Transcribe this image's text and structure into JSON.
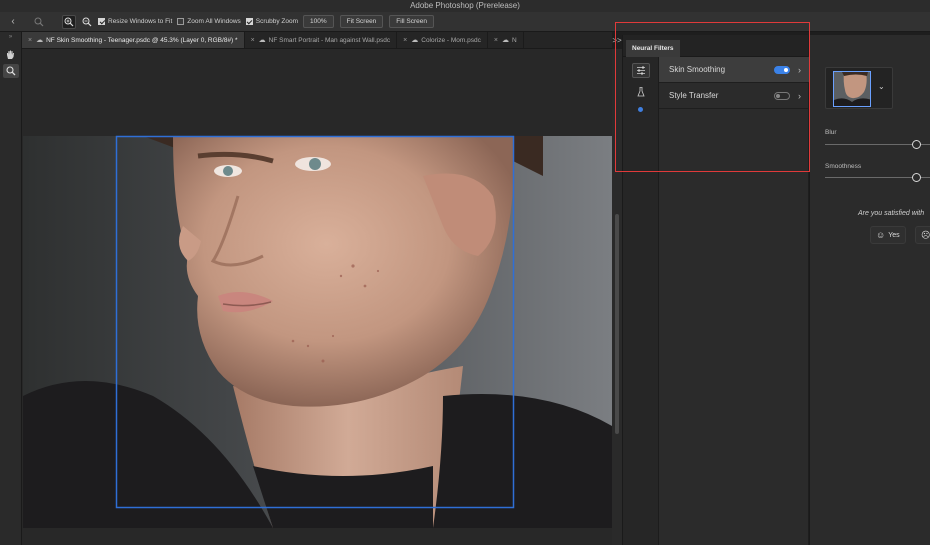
{
  "app": {
    "title": "Adobe Photoshop (Prerelease)"
  },
  "options_bar": {
    "back_icon": "chevron-left-icon",
    "resize_windows": {
      "label": "Resize Windows to Fit",
      "checked": true
    },
    "zoom_all_windows": {
      "label": "Zoom All Windows",
      "checked": false
    },
    "scrubby_zoom": {
      "label": "Scrubby Zoom",
      "checked": true
    },
    "zoom_level": "100%",
    "fit_screen": "Fit Screen",
    "fill_screen": "Fill Screen"
  },
  "tabs": [
    {
      "label": "NF Skin Smoothing - Teenager.psdc @ 45.3% (Layer 0, RGB/8#) *",
      "active": true
    },
    {
      "label": "NF Smart Portrait - Man against Wall.psdc",
      "active": false
    },
    {
      "label": "Colorize - Mom.psdc",
      "active": false
    },
    {
      "label": "N",
      "active": false
    }
  ],
  "neural_filters": {
    "panel_title": "Neural Filters",
    "collapse_label": ">>",
    "filters": [
      {
        "label": "Skin Smoothing",
        "enabled": true,
        "selected": true
      },
      {
        "label": "Style Transfer",
        "enabled": false,
        "selected": false
      }
    ]
  },
  "properties": {
    "blur_label": "Blur",
    "blur_value": 0.86,
    "smoothness_label": "Smoothness",
    "smoothness_value": 0.86,
    "feedback_question": "Are you satisfied with",
    "yes_label": "Yes"
  },
  "colors": {
    "accent": "#3b82e8",
    "highlight": "#e03a3a",
    "selection": "#2f6fd6"
  }
}
